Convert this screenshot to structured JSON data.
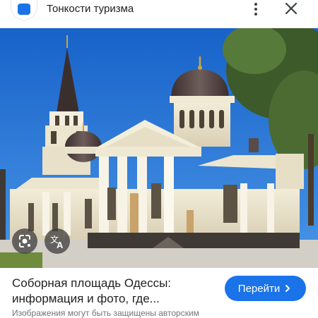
{
  "header": {
    "site_name": "Тонкости туризма",
    "site_icon": "tourism-logo-icon",
    "menu_icon": "more-vert-icon",
    "close_icon": "close-icon"
  },
  "image": {
    "subject": "",
    "actions": [
      {
        "icon": "google-lens-icon"
      },
      {
        "icon": "translate-icon"
      }
    ]
  },
  "result": {
    "title": "Соборная площадь Одессы: информация и фото, где...",
    "button_label": "Перейти",
    "button_icon": "chevron-right-icon",
    "note": "Изображения могут быть защищены авторским"
  },
  "colors": {
    "accent": "#1a73e8",
    "sky": "#1f6fd0",
    "building": "#efe8d2",
    "dome": "#5a4a48"
  }
}
